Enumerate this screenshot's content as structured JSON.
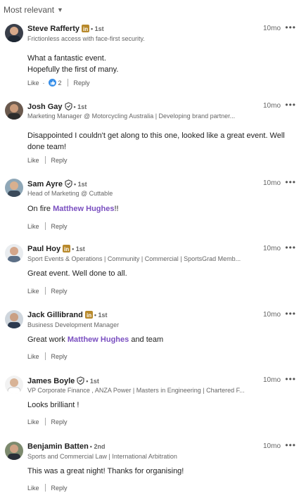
{
  "sort": {
    "label": "Most relevant"
  },
  "comments": [
    {
      "name": "Steve Rafferty",
      "degree": "• 1st",
      "headline": "Frictionless access with face-first security.",
      "time": "10mo",
      "text_line1": "What a fantastic event.",
      "text_line2": "Hopefully the first of many.",
      "like_label": "Like",
      "reaction_count": "2",
      "reply_label": "Reply",
      "badge": "linkedin-premium-icon"
    },
    {
      "name": "Josh Gay",
      "degree": "• 1st",
      "headline": "Marketing Manager @ Motorcycling Australia | Developing brand partner...",
      "time": "10mo",
      "text": "Disappointed I couldn't get along to this one, looked like a great event. Well done team!",
      "like_label": "Like",
      "reply_label": "Reply",
      "badge": "verified-shield-icon"
    },
    {
      "name": "Sam Ayre",
      "degree": "• 1st",
      "headline": "Head of Marketing @ Cuttable",
      "time": "10mo",
      "text_pre": "On fire ",
      "mention": "Matthew Hughes",
      "text_post": "!!",
      "like_label": "Like",
      "reply_label": "Reply",
      "badge": "verified-shield-icon"
    },
    {
      "name": "Paul Hoy",
      "degree": "• 1st",
      "headline": "Sport Events & Operations | Community | Commercial | SportsGrad Memb...",
      "time": "10mo",
      "text": "Great event. Well done to all.",
      "like_label": "Like",
      "reply_label": "Reply",
      "badge": "linkedin-premium-icon"
    },
    {
      "name": "Jack Gillibrand",
      "degree": "• 1st",
      "headline": "Business Development Manager",
      "time": "10mo",
      "text_pre": "Great work ",
      "mention": "Matthew Hughes",
      "text_post": " and team",
      "like_label": "Like",
      "reply_label": "Reply",
      "badge": "linkedin-premium-icon"
    },
    {
      "name": "James Boyle",
      "degree": "• 1st",
      "headline": "VP Corporate Finance , ANZA Power | Masters in Engineering | Chartered F...",
      "time": "10mo",
      "text": "Looks brilliant !",
      "like_label": "Like",
      "reply_label": "Reply",
      "badge": "verified-shield-icon"
    },
    {
      "name": "Benjamin Batten",
      "degree": "• 2nd",
      "headline": "Sports and Commercial Law | International Arbitration",
      "time": "10mo",
      "text": "This was a great night! Thanks for organising!",
      "like_label": "Like",
      "reply_label": "Reply",
      "badge": ""
    }
  ],
  "colors": {
    "mention": "#7a4fc0",
    "premium": "#b8892b",
    "like_blue": "#378fe9"
  }
}
